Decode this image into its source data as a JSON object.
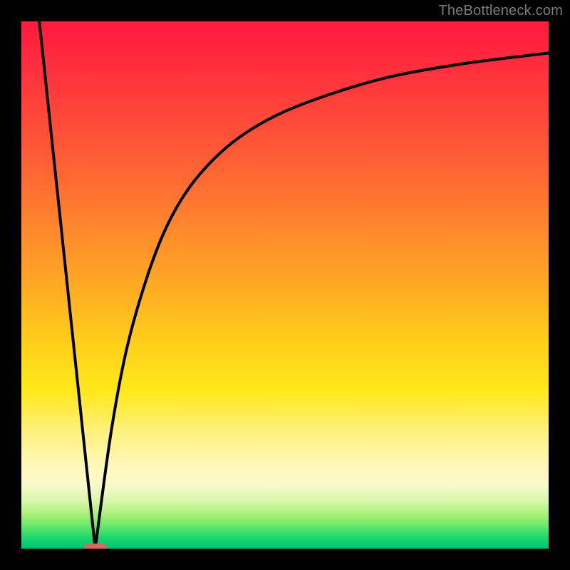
{
  "watermark": "TheBottleneck.com",
  "chart_data": {
    "type": "line",
    "title": "",
    "xlabel": "",
    "ylabel": "",
    "xlim": [
      0,
      100
    ],
    "ylim": [
      0,
      100
    ],
    "grid": false,
    "legend": false,
    "notch_x": 14,
    "series": [
      {
        "name": "left-slope",
        "x": [
          3.4,
          14
        ],
        "values": [
          100,
          0
        ]
      },
      {
        "name": "right-curve",
        "x": [
          14,
          17,
          20,
          24,
          28,
          33,
          40,
          48,
          58,
          70,
          84,
          100
        ],
        "values": [
          0,
          22,
          38,
          52,
          62,
          70,
          77,
          82,
          86,
          89.5,
          92,
          94
        ]
      }
    ],
    "marker": {
      "name": "notch-marker",
      "x": 14,
      "y": 0,
      "width_pct": 4.5,
      "height_pct": 1.7,
      "color": "#d8695f"
    },
    "gradient_stops": [
      {
        "pct": 0,
        "color": "#ff1a3e"
      },
      {
        "pct": 25,
        "color": "#ff5a36"
      },
      {
        "pct": 52,
        "color": "#ffb022"
      },
      {
        "pct": 70,
        "color": "#ffe81a"
      },
      {
        "pct": 88,
        "color": "#f8f9cc"
      },
      {
        "pct": 96,
        "color": "#4be36a"
      },
      {
        "pct": 100,
        "color": "#00c173"
      }
    ]
  }
}
